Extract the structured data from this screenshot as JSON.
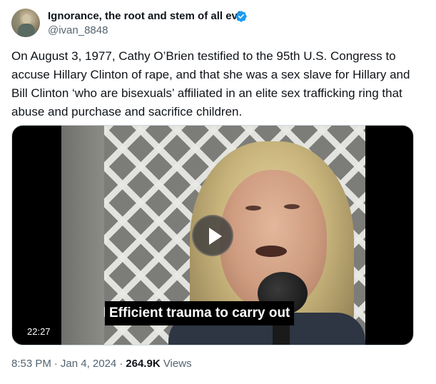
{
  "author": {
    "display_name": "Ignorance, the root and stem of all evil",
    "handle": "@ivan_8848",
    "verified_icon": "verified-badge-icon",
    "verified_color": "#1d9bf0"
  },
  "tweet": {
    "text": "On August 3, 1977, Cathy O’Brien testified to the 95th U.S. Congress to accuse Hillary Clinton of rape, and that she was a sex slave for Hillary and Bill Clinton ‘who are bisexuals’ affiliated in an elite sex trafficking ring that abuse and purchase and sacrifice children."
  },
  "video": {
    "caption": "Efficient trauma to carry out",
    "duration": "22:27",
    "play_icon": "play-icon"
  },
  "meta": {
    "time": "8:53 PM",
    "separator": "·",
    "date": "Jan 4, 2024",
    "views_count": "264.9K",
    "views_label": "Views"
  }
}
